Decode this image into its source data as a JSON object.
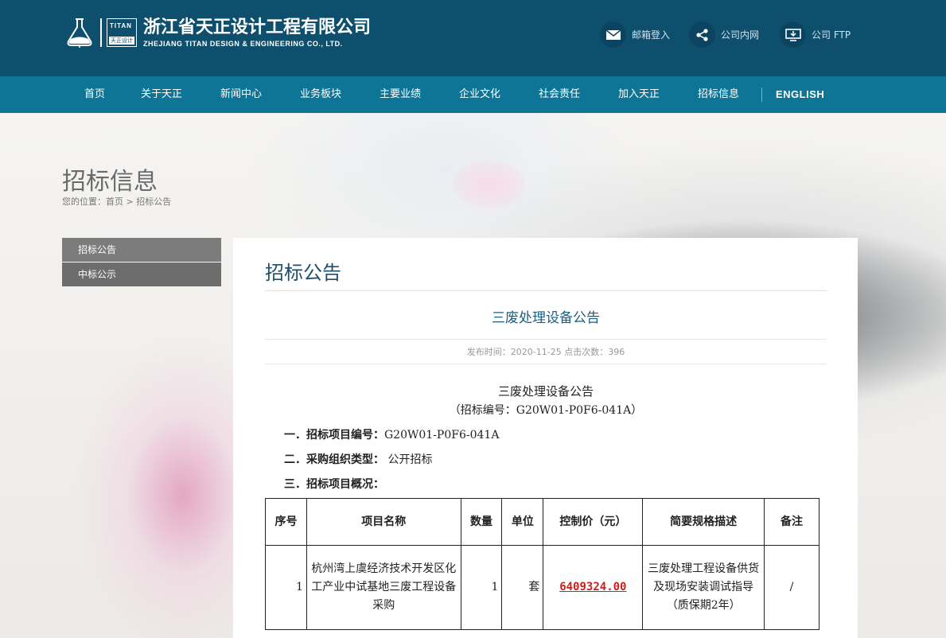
{
  "header": {
    "company_cn": "浙江省天正设计工程有限公司",
    "company_en": "ZHEJIANG TITAN DESIGN & ENGINEERING CO., LTD.",
    "logo_box_en": "TITAN",
    "logo_box_cn": "天正设计",
    "tools": [
      {
        "label": "邮箱登入",
        "icon": "mail-icon"
      },
      {
        "label": "公司内网",
        "icon": "share-icon"
      },
      {
        "label": "公司 FTP",
        "icon": "ftp-monitor-icon"
      }
    ]
  },
  "nav": [
    "首页",
    "关于天正",
    "新闻中心",
    "业务板块",
    "主要业绩",
    "企业文化",
    "社会责任",
    "加入天正",
    "招标信息",
    "ENGLISH"
  ],
  "page": {
    "title": "招标信息",
    "breadcrumb_prefix": "您的位置：",
    "breadcrumb_home": "首页",
    "breadcrumb_sep": " > ",
    "breadcrumb_current": "招标公告"
  },
  "sidebar": [
    "招标公告",
    "中标公示"
  ],
  "content": {
    "section_title": "招标公告",
    "article_title": "三废处理设备公告",
    "meta": "发布时间：2020-11-25 点击次数：396",
    "doc_title": "三废处理设备公告",
    "doc_code": "（招标编号：G20W01-P0F6-041A）",
    "items": [
      {
        "label": "一．招标项目编号：",
        "value": "G20W01-P0F6-041A"
      },
      {
        "label": "二．采购组织类型：",
        "value": " 公开招标"
      },
      {
        "label": "三．招标项目概况：",
        "value": ""
      }
    ],
    "table": {
      "headers": [
        "序号",
        "项目名称",
        "数量",
        "单位",
        "控制价（元）",
        "简要规格描述",
        "备注"
      ],
      "rows": [
        [
          "1",
          "杭州湾上虞经济技术开发区化工产业中试基地三废工程设备采购",
          "1",
          "套",
          "6409324.00",
          "三废处理工程设备供货及现场安装调试指导（质保期2年）",
          "/"
        ]
      ]
    }
  }
}
